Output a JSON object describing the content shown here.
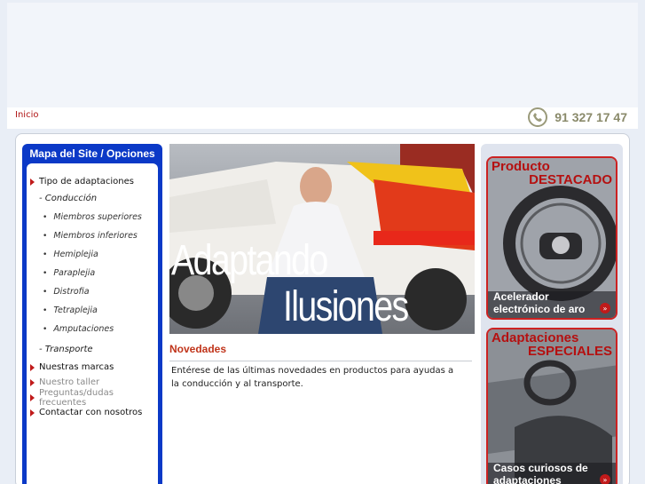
{
  "breadcrumb": "Inicio",
  "phone": "91 327 17 47",
  "sidebar": {
    "title": "Mapa del Site / Opciones",
    "items": [
      {
        "label": "Tipo de adaptaciones"
      },
      {
        "label": "- Conducción"
      },
      {
        "label": "Miembros superiores"
      },
      {
        "label": "Miembros inferiores"
      },
      {
        "label": "Hemiplejia"
      },
      {
        "label": "Paraplejia"
      },
      {
        "label": "Distrofia"
      },
      {
        "label": "Tetraplejia"
      },
      {
        "label": "Amputaciones"
      },
      {
        "label": "- Transporte"
      },
      {
        "label": "Nuestras marcas"
      },
      {
        "label": "Nuestro taller"
      },
      {
        "label": "Preguntas/dudas frecuentes"
      },
      {
        "label": "Contactar con nosotros"
      }
    ]
  },
  "hero": {
    "line1": "Adaptando",
    "line2": "Ilusiones"
  },
  "news": {
    "title": "Novedades",
    "body": "Entérese de las últimas novedades en productos para ayudas a la conducción y al transporte."
  },
  "promos": [
    {
      "head1": "Producto",
      "head2": "DESTACADO",
      "caption": "Acelerador electrónico de aro"
    },
    {
      "head1": "Adaptaciones",
      "head2": "ESPECIALES",
      "caption": "Casos curiosos de adaptaciones"
    }
  ],
  "colors": {
    "accent": "#c01a1a",
    "nav_blue": "#0b39c7"
  }
}
